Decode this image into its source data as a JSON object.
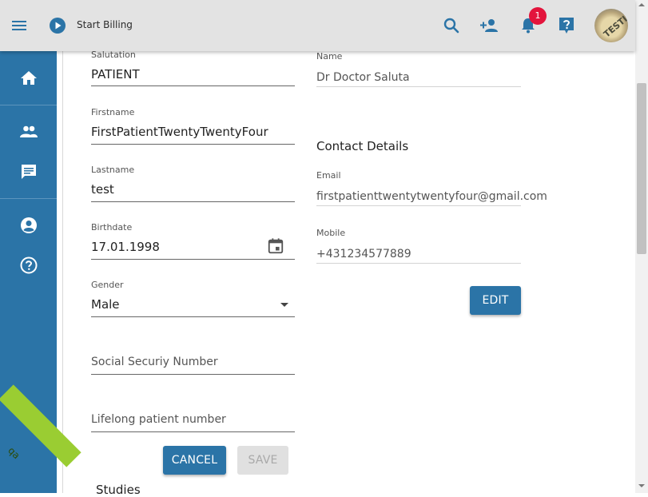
{
  "topbar": {
    "start_billing": "Start Billing",
    "notification_count": "1",
    "avatar_text": "TESTIN"
  },
  "sidebar": {
    "qa_label": "qa"
  },
  "form": {
    "salutation": {
      "label": "Salutation",
      "value": "PATIENT"
    },
    "firstname": {
      "label": "Firstname",
      "value": "FirstPatientTwentyTwentyFour"
    },
    "lastname": {
      "label": "Lastname",
      "value": "test"
    },
    "birthdate": {
      "label": "Birthdate",
      "value": "17.01.1998"
    },
    "gender": {
      "label": "Gender",
      "value": "Male"
    },
    "ssn": {
      "placeholder": "Social Securiy Number"
    },
    "lifelong": {
      "placeholder": "Lifelong patient number"
    },
    "cancel_label": "CANCEL",
    "save_label": "SAVE",
    "studies_label": "Studies"
  },
  "doctor": {
    "name_label": "Name",
    "name_value": "Dr Doctor Saluta",
    "contact_title": "Contact Details",
    "email_label": "Email",
    "email_value": "firstpatienttwentytwentyfour@gmail.com",
    "mobile_label": "Mobile",
    "mobile_value": "+431234577889",
    "edit_label": "EDIT"
  },
  "colors": {
    "primary": "#2b74a7",
    "topbar": "#e3e3e3",
    "badge": "#e3143c",
    "qa_ribbon": "#9acd32"
  }
}
